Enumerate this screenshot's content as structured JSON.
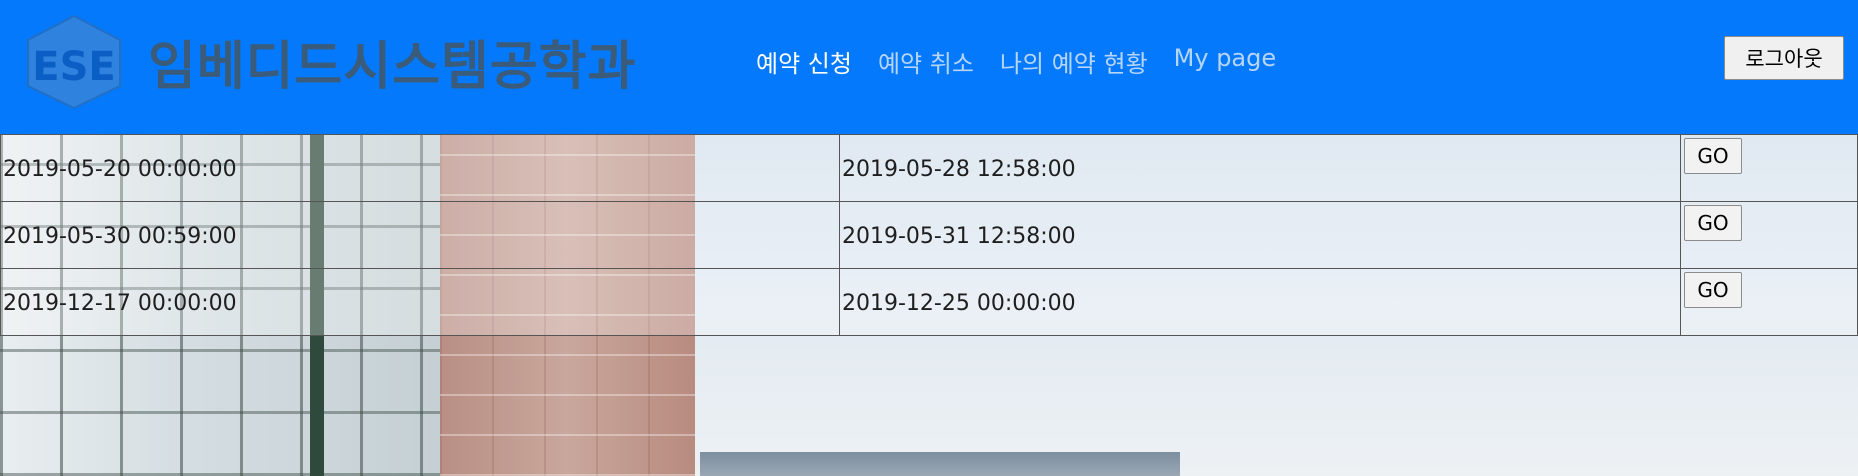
{
  "header": {
    "logo_text": "ESE",
    "site_title": "임베디드시스템공학과",
    "logout_label": "로그아웃",
    "colors": {
      "header_bg": "#0479fb",
      "nav_active": "#ffffff",
      "nav_inactive": "#b7d5f7"
    }
  },
  "nav": {
    "items": [
      {
        "label": "예약 신청",
        "active": true
      },
      {
        "label": "예약 취소",
        "active": false
      },
      {
        "label": "나의 예약 현황",
        "active": false
      },
      {
        "label": "My page",
        "active": false
      }
    ]
  },
  "reservations": {
    "rows": [
      {
        "start": "2019-05-20 00:00:00",
        "end": "2019-05-28 12:58:00",
        "action": "GO"
      },
      {
        "start": "2019-05-30 00:59:00",
        "end": "2019-05-31 12:58:00",
        "action": "GO"
      },
      {
        "start": "2019-12-17 00:00:00",
        "end": "2019-12-25 00:00:00",
        "action": "GO"
      }
    ]
  }
}
